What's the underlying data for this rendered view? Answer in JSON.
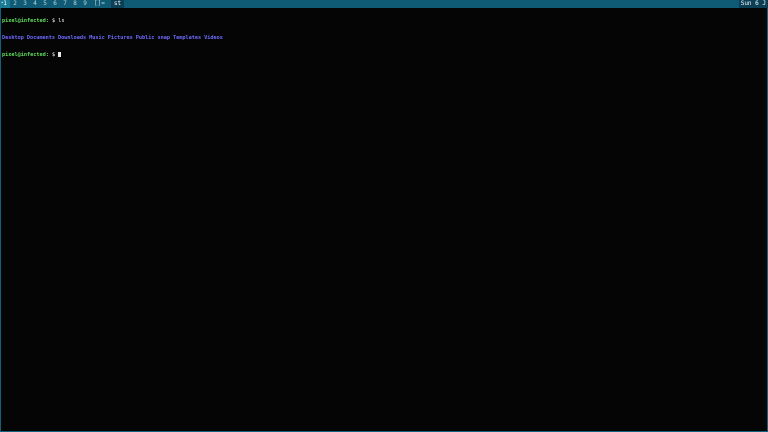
{
  "topbar": {
    "workspaces": [
      "1",
      "2",
      "3",
      "4",
      "5",
      "6",
      "7",
      "8",
      "9"
    ],
    "active_index": 0,
    "active_marker": "•",
    "layout_indicator": "[]=",
    "window_title": "st",
    "clock": "Sun 6 J"
  },
  "terminal": {
    "prompt": "pixel@infected:",
    "prompt_suffix": "$",
    "command": "ls",
    "listing": [
      "Desktop",
      "Documents",
      "Downloads",
      "Music",
      "Pictures",
      "Public",
      "snap",
      "Templates",
      "Videos"
    ]
  },
  "colors": {
    "bar_background": "#0f5a74",
    "active_tag": "#1a7b95",
    "prompt": "#5fe05f",
    "directory": "#6f6bff",
    "terminal_bg": "#050505"
  }
}
